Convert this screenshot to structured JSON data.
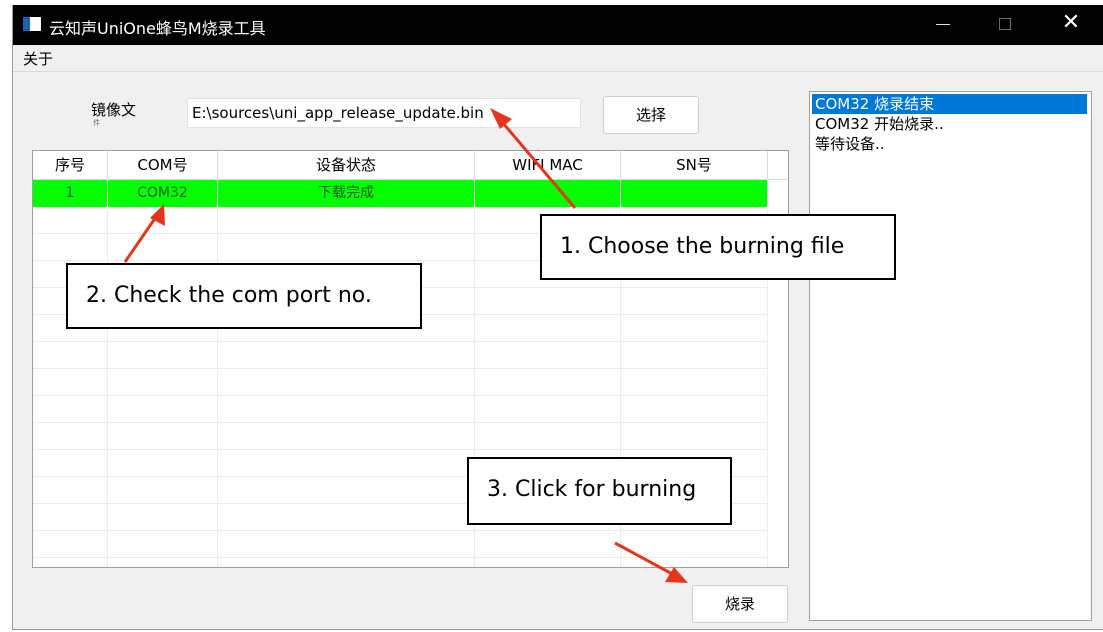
{
  "window": {
    "title": "云知声UniOne蜂鸟M烧录工具",
    "close_glyph": "✕"
  },
  "menu": {
    "about": "关于"
  },
  "file": {
    "label": "镜像文",
    "label_sub": "件",
    "path": "E:\\sources\\uni_app_release_update.bin",
    "select_button": "选择"
  },
  "table": {
    "columns": [
      "序号",
      "COM号",
      "设备状态",
      "WIFI MAC",
      "SN号"
    ],
    "rows": [
      [
        "1",
        "COM32",
        "下载完成",
        "",
        ""
      ]
    ],
    "active_row_color": "#00ff00"
  },
  "log": {
    "lines": [
      "COM32 烧录结束",
      "COM32 开始烧录..",
      "等待设备.."
    ]
  },
  "burn_button": "烧录",
  "annotations": {
    "callout_1": "1.  Choose the burning file",
    "callout_2": "2.  Check the com port no.",
    "callout_3": "3.  Click for burning",
    "arrow_color": "#e8341c"
  }
}
